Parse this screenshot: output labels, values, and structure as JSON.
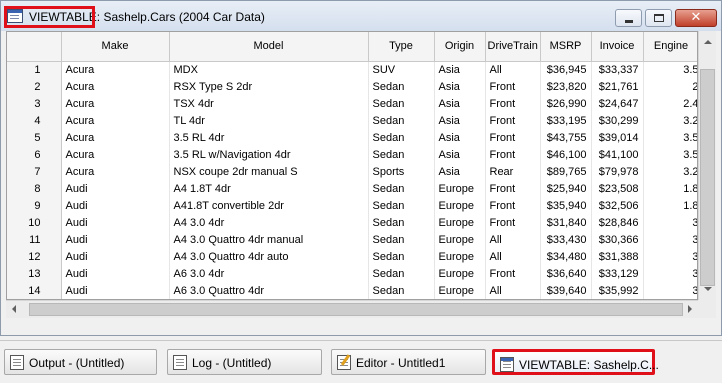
{
  "window": {
    "title_app": "VIEWTABLE:",
    "title_rest": " Sashelp.Cars (2004 Car Data)",
    "close_symbol": "✕"
  },
  "table": {
    "columns": [
      "",
      "Make",
      "Model",
      "Type",
      "Origin",
      "DriveTrain",
      "MSRP",
      "Invoice",
      "Engine"
    ],
    "rows": [
      [
        "1",
        "Acura",
        "MDX",
        "SUV",
        "Asia",
        "All",
        "$36,945",
        "$33,337",
        "3.5"
      ],
      [
        "2",
        "Acura",
        "RSX Type S 2dr",
        "Sedan",
        "Asia",
        "Front",
        "$23,820",
        "$21,761",
        "2"
      ],
      [
        "3",
        "Acura",
        "TSX 4dr",
        "Sedan",
        "Asia",
        "Front",
        "$26,990",
        "$24,647",
        "2.4"
      ],
      [
        "4",
        "Acura",
        "TL 4dr",
        "Sedan",
        "Asia",
        "Front",
        "$33,195",
        "$30,299",
        "3.2"
      ],
      [
        "5",
        "Acura",
        "3.5 RL 4dr",
        "Sedan",
        "Asia",
        "Front",
        "$43,755",
        "$39,014",
        "3.5"
      ],
      [
        "6",
        "Acura",
        "3.5 RL w/Navigation 4dr",
        "Sedan",
        "Asia",
        "Front",
        "$46,100",
        "$41,100",
        "3.5"
      ],
      [
        "7",
        "Acura",
        "NSX coupe 2dr manual S",
        "Sports",
        "Asia",
        "Rear",
        "$89,765",
        "$79,978",
        "3.2"
      ],
      [
        "8",
        "Audi",
        "A4 1.8T 4dr",
        "Sedan",
        "Europe",
        "Front",
        "$25,940",
        "$23,508",
        "1.8"
      ],
      [
        "9",
        "Audi",
        "A41.8T convertible 2dr",
        "Sedan",
        "Europe",
        "Front",
        "$35,940",
        "$32,506",
        "1.8"
      ],
      [
        "10",
        "Audi",
        "A4 3.0 4dr",
        "Sedan",
        "Europe",
        "Front",
        "$31,840",
        "$28,846",
        "3"
      ],
      [
        "11",
        "Audi",
        "A4 3.0 Quattro 4dr manual",
        "Sedan",
        "Europe",
        "All",
        "$33,430",
        "$30,366",
        "3"
      ],
      [
        "12",
        "Audi",
        "A4 3.0 Quattro 4dr auto",
        "Sedan",
        "Europe",
        "All",
        "$34,480",
        "$31,388",
        "3"
      ],
      [
        "13",
        "Audi",
        "A6 3.0 4dr",
        "Sedan",
        "Europe",
        "Front",
        "$36,640",
        "$33,129",
        "3"
      ],
      [
        "14",
        "Audi",
        "A6 3.0 Quattro 4dr",
        "Sedan",
        "Europe",
        "All",
        "$39,640",
        "$35,992",
        "3"
      ]
    ]
  },
  "taskbar": {
    "items": [
      {
        "label": "Output - (Untitled)",
        "icon": "output-window-icon"
      },
      {
        "label": "Log - (Untitled)",
        "icon": "log-window-icon"
      },
      {
        "label": "Editor - Untitled1",
        "icon": "editor-window-icon"
      },
      {
        "label": "VIEWTABLE: Sashelp.C...",
        "icon": "viewtable-window-icon",
        "active": true
      }
    ]
  },
  "colors": {
    "highlight": "#e0101a",
    "titlebar": "#d4dfee",
    "header_bg": "#f4f4f4"
  }
}
